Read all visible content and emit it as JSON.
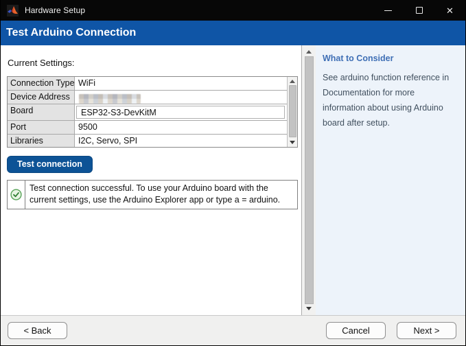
{
  "window": {
    "title": "Hardware Setup",
    "controls": {
      "minimize": "minimize",
      "maximize": "maximize",
      "close": "✕"
    }
  },
  "header": {
    "title": "Test Arduino Connection"
  },
  "main": {
    "section_label": "Current Settings:",
    "settings_table": {
      "rows": [
        {
          "label": "Connection Type",
          "value": "WiFi"
        },
        {
          "label": "Device Address",
          "value": "",
          "value_redacted": true
        },
        {
          "label": "Board",
          "value": "ESP32-S3-DevKitM",
          "editable": true
        },
        {
          "label": "Port",
          "value": "9500"
        },
        {
          "label": "Libraries",
          "value": "I2C, Servo, SPI"
        }
      ]
    },
    "test_button_label": "Test connection",
    "status": {
      "icon": "check-circle-icon",
      "message": "Test connection successful. To use your Arduino board with the current settings, use the Arduino Explorer app or type a = arduino."
    }
  },
  "sidebar": {
    "heading": "What to Consider",
    "body": "See arduino function reference in Documentation for more information about using Arduino board after setup."
  },
  "footer": {
    "back_label": "< Back",
    "cancel_label": "Cancel",
    "next_label": "Next >"
  },
  "colors": {
    "titlebar_bg": "#070707",
    "header_blue": "#0f55a6",
    "button_blue": "#0d5396",
    "sidebar_bg": "#edf3fa",
    "sidebar_heading_blue": "#3f6fb5",
    "success_green": "#3f9542",
    "table_label_bg": "#e3e3e3",
    "footer_bg": "#f0f0ef"
  }
}
